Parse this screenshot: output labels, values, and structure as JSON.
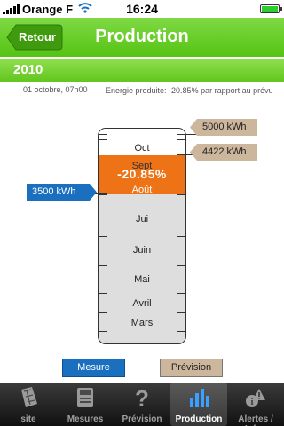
{
  "status_bar": {
    "carrier": "Orange F",
    "time": "16:24"
  },
  "nav": {
    "back_label": "Retour",
    "title": "Production"
  },
  "year": "2010",
  "info": {
    "date": "01 octobre, 07h00",
    "energy": "Energie produite: -20.85% par rapport au prévu"
  },
  "gauge": {
    "months_top_to_bottom": [
      "Oct",
      "Sept",
      "Août",
      "Jui",
      "Juin",
      "Mai",
      "Avril",
      "Mars"
    ],
    "percent_label": "-20.85%",
    "callouts": {
      "target": "5000 kWh",
      "forecast": "4422 kWh",
      "measured": "3500 kWh"
    },
    "colors": {
      "measured": "#1a6fbe",
      "forecast": "#ccb69c",
      "gap": "#ee7216"
    }
  },
  "legend": {
    "mesure": "Mesure",
    "prevision": "Prévision"
  },
  "tabs": [
    {
      "label": "site",
      "icon": "solar-panel-icon"
    },
    {
      "label": "Mesures",
      "icon": "meter-icon"
    },
    {
      "label": "Prévision",
      "icon": "question-mark-icon"
    },
    {
      "label": "Production",
      "icon": "bar-chart-icon",
      "selected": true
    },
    {
      "label": "Alertes / Infos",
      "icon": "alert-info-icon"
    }
  ]
}
